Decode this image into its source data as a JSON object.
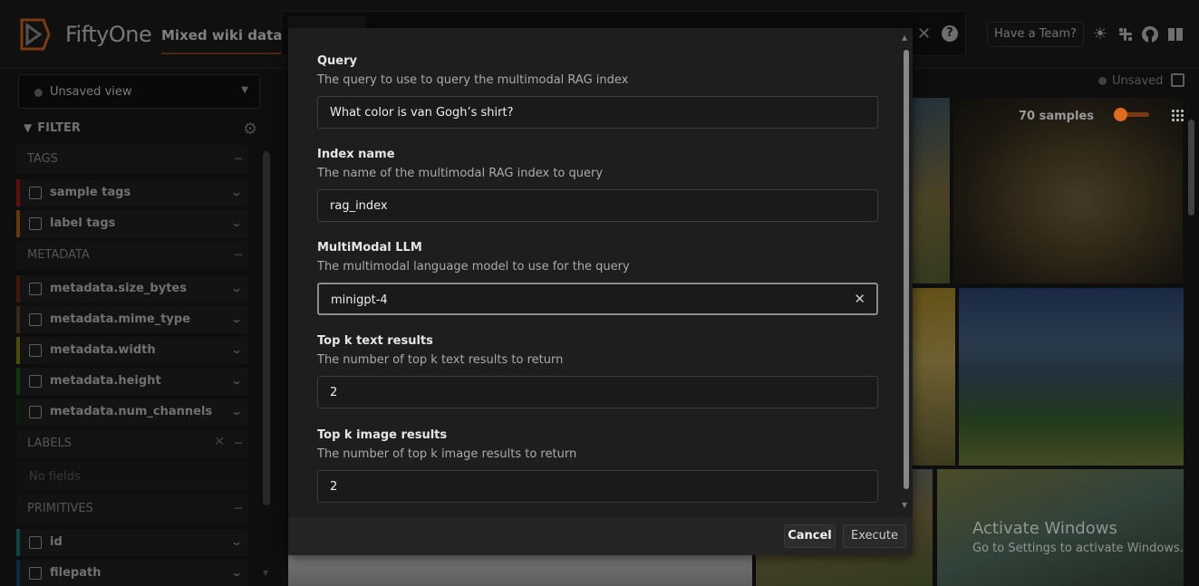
{
  "header": {
    "app_name": "FiftyOne",
    "dataset_name": "Mixed wiki data",
    "team_button": "Have a Team?",
    "help_glyph": "?",
    "close_glyph": "✕"
  },
  "sidebar": {
    "view_select": "Unsaved view",
    "filter_label": "FILTER",
    "sections": {
      "tags": "TAGS",
      "metadata": "METADATA",
      "labels": "LABELS",
      "primitives": "PRIMITIVES"
    },
    "no_fields": "No fields",
    "fields": [
      {
        "label": "sample tags",
        "color": "#b0181b"
      },
      {
        "label": "label tags",
        "color": "#c2640f"
      },
      {
        "label": "metadata.size_bytes",
        "color": "#7a2a12"
      },
      {
        "label": "metadata.mime_type",
        "color": "#6b4a2a"
      },
      {
        "label": "metadata.width",
        "color": "#8a8a12"
      },
      {
        "label": "metadata.height",
        "color": "#1c6a1c"
      },
      {
        "label": "metadata.num_channels",
        "color": "#123a14"
      },
      {
        "label": "id",
        "color": "#138080"
      },
      {
        "label": "filepath",
        "color": "#1a4a8a"
      }
    ]
  },
  "content": {
    "unsaved_label": "Unsaved",
    "samples_count": "70 samples",
    "slider_value": 0.1
  },
  "modal": {
    "fields": [
      {
        "title": "Query",
        "description": "The query to use to query the multimodal RAG index",
        "value": "What color is van Gogh’s shirt?"
      },
      {
        "title": "Index name",
        "description": "The name of the multimodal RAG index to query",
        "value": "rag_index"
      },
      {
        "title": "MultiModal LLM",
        "description": "The multimodal language model to use for the query",
        "value": "minigpt-4"
      },
      {
        "title": "Top k text results",
        "description": "The number of top k text results to return",
        "value": "2"
      },
      {
        "title": "Top k image results",
        "description": "The number of top k image results to return",
        "value": "2"
      }
    ],
    "cancel_label": "Cancel",
    "execute_label": "Execute"
  },
  "watermark": {
    "title": "Activate Windows",
    "subtitle": "Go to Settings to activate Windows."
  },
  "colors": {
    "accent": "#e06a1d",
    "background": "#1b1b1b"
  }
}
